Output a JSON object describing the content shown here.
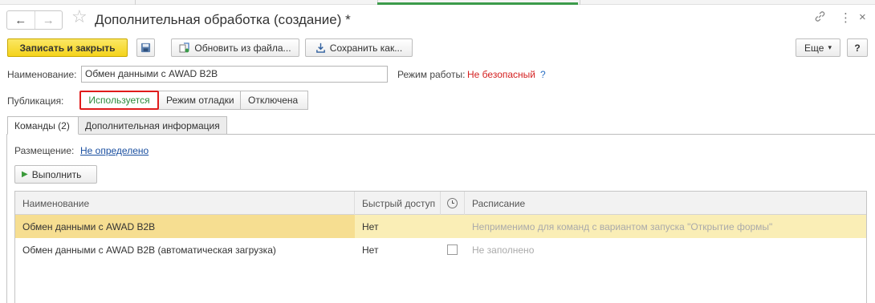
{
  "window": {
    "title": "Дополнительная обработка (создание) *",
    "back_icon": "←",
    "forward_icon": "→",
    "star_icon": "☆",
    "link_icon": "🔗",
    "more_icon": "⋮",
    "close_icon": "×"
  },
  "toolbar": {
    "save_close_label": "Записать и закрыть",
    "save_icon": "💾",
    "update_from_file_label": "Обновить из файла...",
    "save_as_label": "Сохранить как...",
    "more_label": "Еще",
    "more_arrow": "▾",
    "help_label": "?"
  },
  "form": {
    "name_label": "Наименование:",
    "name_value": "Обмен данными с AWAD B2B",
    "mode_label": "Режим работы:",
    "mode_value": "Не безопасный",
    "mode_help": "?",
    "publication_label": "Публикация:",
    "publication_options": [
      "Используется",
      "Режим отладки",
      "Отключена"
    ],
    "publication_selected": "Используется"
  },
  "tabs": [
    {
      "label": "Команды (2)",
      "active": true
    },
    {
      "label": "Дополнительная информация",
      "active": false
    }
  ],
  "commands": {
    "placement_label": "Размещение:",
    "placement_value": "Не определено",
    "run_label": "Выполнить",
    "run_icon": "▶"
  },
  "table": {
    "columns": [
      "Наименование",
      "Быстрый доступ",
      "clock-icon",
      "Расписание"
    ],
    "rows": [
      {
        "name": "Обмен данными с AWAD B2B",
        "quick": "Нет",
        "schedule": "Неприменимо для команд с вариантом запуска \"Открытие формы\"",
        "has_checkbox": false,
        "selected": true
      },
      {
        "name": "Обмен данными с AWAD B2B (автоматическая загрузка)",
        "quick": "Нет",
        "schedule": "Не заполнено",
        "has_checkbox": true,
        "checked": false,
        "selected": false
      }
    ]
  },
  "colors": {
    "primary_button": "#f4d31b",
    "selected_row": "#faeeb6",
    "active_option": "#2c8a3c",
    "highlight_border": "#e01b1b",
    "unsafe_text": "#d42020"
  }
}
